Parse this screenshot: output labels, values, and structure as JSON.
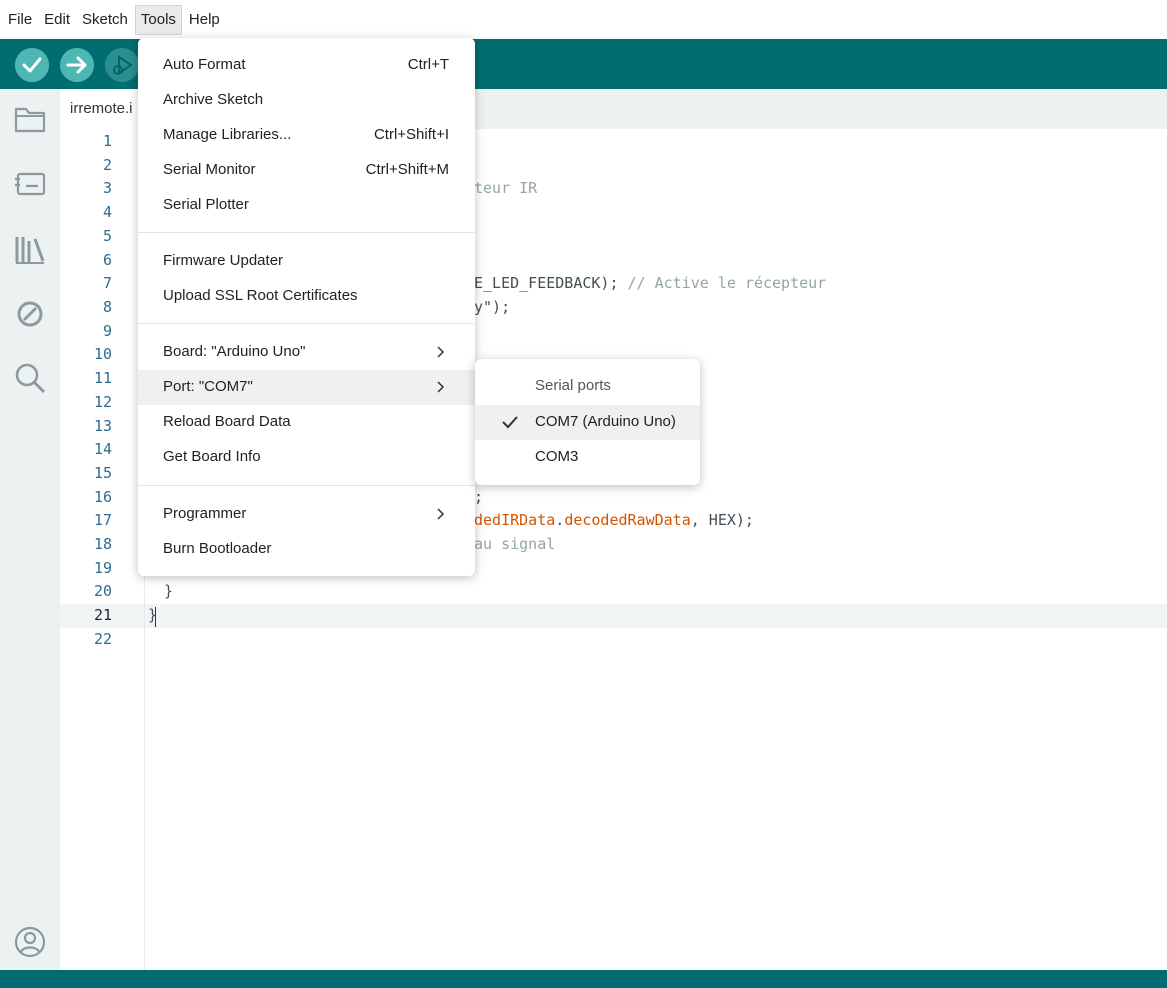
{
  "menubar": {
    "items": [
      "File",
      "Edit",
      "Sketch",
      "Tools",
      "Help"
    ],
    "active": "Tools"
  },
  "editor": {
    "tab_label": "irremote.i",
    "line_numbers": [
      "1",
      "2",
      "3",
      "4",
      "5",
      "6",
      "7",
      "8",
      "9",
      "10",
      "11",
      "12",
      "13",
      "14",
      "15",
      "16",
      "17",
      "18",
      "19",
      "20",
      "21",
      "22"
    ],
    "current_line": "21",
    "code_fragments": {
      "l3": "teur IR",
      "l7_code": "E_LED_FEEDBACK); ",
      "l7_comment": "// Active le récepteur",
      "l8": "y\");",
      "l16": ";",
      "l17_a": "dedIRData",
      "l17_dot": ".",
      "l17_b": "decodedRawData",
      "l17_c": ", HEX);",
      "l18": "au signal",
      "l20": "}",
      "l21": "}"
    }
  },
  "tools_menu": {
    "group1": [
      {
        "label": "Auto Format",
        "shortcut": "Ctrl+T"
      },
      {
        "label": "Archive Sketch",
        "shortcut": ""
      },
      {
        "label": "Manage Libraries...",
        "shortcut": "Ctrl+Shift+I"
      },
      {
        "label": "Serial Monitor",
        "shortcut": "Ctrl+Shift+M"
      },
      {
        "label": "Serial Plotter",
        "shortcut": ""
      }
    ],
    "group2": [
      {
        "label": "Firmware Updater"
      },
      {
        "label": "Upload SSL Root Certificates"
      }
    ],
    "group3": [
      {
        "label": "Board: \"Arduino Uno\""
      },
      {
        "label": "Port: \"COM7\""
      },
      {
        "label": "Reload Board Data"
      },
      {
        "label": "Get Board Info"
      }
    ],
    "group4": [
      {
        "label": "Programmer"
      },
      {
        "label": "Burn Bootloader"
      }
    ]
  },
  "port_submenu": {
    "header": "Serial ports",
    "items": [
      {
        "label": "COM7 (Arduino Uno)",
        "checked": true
      },
      {
        "label": "COM3",
        "checked": false
      }
    ]
  },
  "icons": {
    "toolbar": [
      "verify-icon",
      "upload-icon",
      "debug-icon"
    ],
    "sidebar": [
      "folder-icon",
      "board-manager-icon",
      "library-icon",
      "debug-disabled-icon",
      "search-icon",
      "account-icon"
    ]
  },
  "colors": {
    "teal": "#006d70",
    "sidebar": "#ecf1f1"
  }
}
